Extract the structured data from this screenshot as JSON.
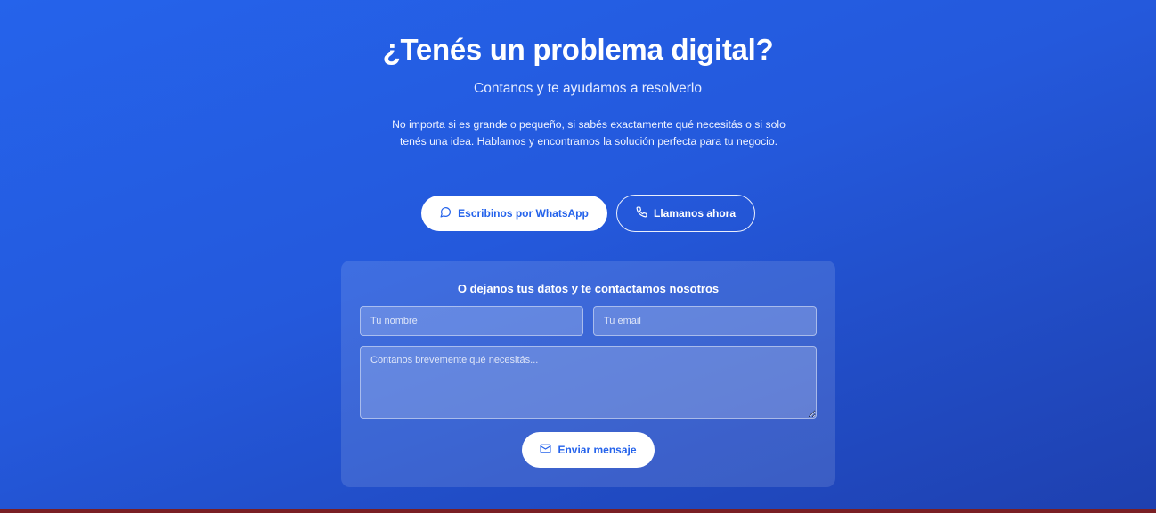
{
  "hero": {
    "title": "¿Tenés un problema digital?",
    "subtitle": "Contanos y te ayudamos a resolverlo",
    "description": "No importa si es grande o pequeño, si sabés exactamente qué necesitás o si solo tenés una idea. Hablamos y encontramos la solución perfecta para tu negocio."
  },
  "actions": {
    "whatsapp_label": "Escribinos por WhatsApp",
    "whatsapp_icon": "message-circle-icon",
    "call_label": "Llamanos ahora",
    "call_icon": "phone-icon"
  },
  "form": {
    "title": "O dejanos tus datos y te contactamos nosotros",
    "name_placeholder": "Tu nombre",
    "email_placeholder": "Tu email",
    "message_placeholder": "Contanos brevemente qué necesitás...",
    "submit_label": "Enviar mensaje",
    "submit_icon": "mail-icon"
  },
  "colors": {
    "background_start": "#2563eb",
    "background_end": "#1e40af",
    "accent": "#2563eb",
    "bottom_bar": "#7a1f24"
  }
}
